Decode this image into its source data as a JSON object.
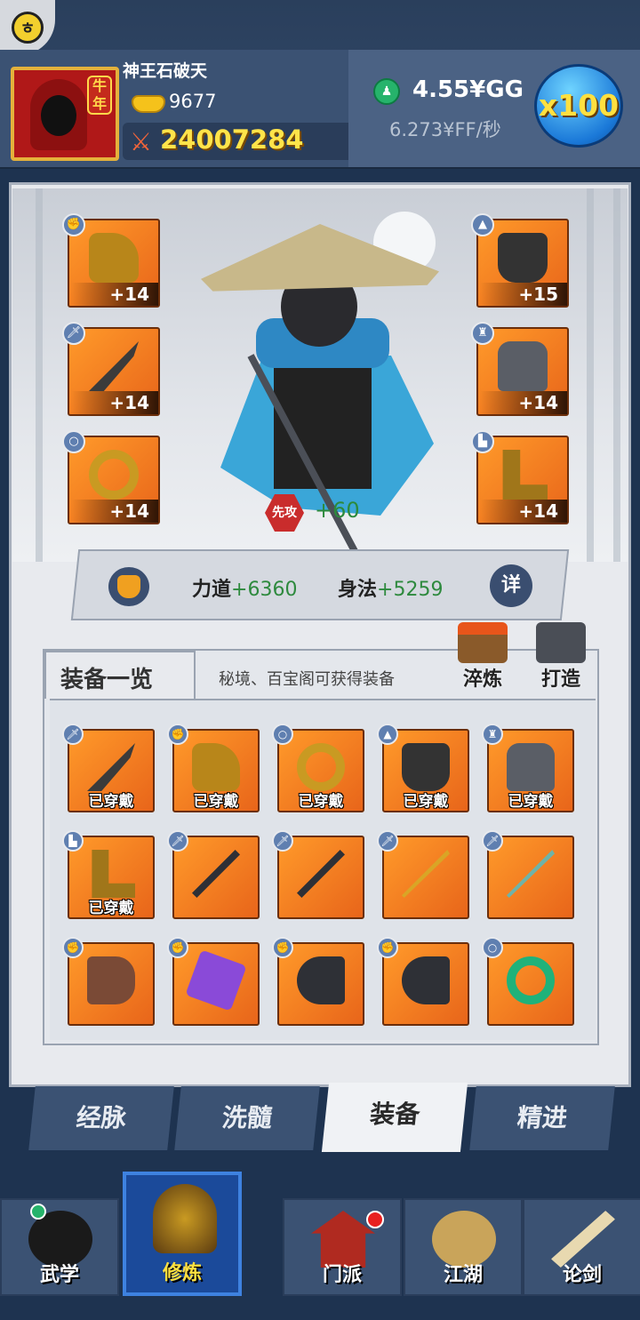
{
  "header": {
    "player_name": "神王石破天",
    "avatar_badge": "牛年",
    "gold": "9677",
    "power": "24007284",
    "gg_amount": "4.55¥GG",
    "ff_rate": "6.273¥FF/秒",
    "multiplier": "x100"
  },
  "character": {
    "initiative_label": "先攻",
    "initiative_value": "+60",
    "slots": [
      {
        "name": "helmet",
        "level": "+14",
        "type_icon": "gauntlet"
      },
      {
        "name": "weapon",
        "level": "+14",
        "type_icon": "sword"
      },
      {
        "name": "ring",
        "level": "+14",
        "type_icon": "ring"
      },
      {
        "name": "hat",
        "level": "+15",
        "type_icon": "hat"
      },
      {
        "name": "armor",
        "level": "+14",
        "type_icon": "armor"
      },
      {
        "name": "boots",
        "level": "+14",
        "type_icon": "boot"
      }
    ]
  },
  "stats": {
    "strength_label": "力道",
    "strength_value": "+6360",
    "agility_label": "身法",
    "agility_value": "+5259",
    "detail_label": "详"
  },
  "equipment_list": {
    "title": "装备一览",
    "hint": "秘境、百宝阁可获得装备",
    "temper_label": "淬炼",
    "forge_label": "打造",
    "worn_label": "已穿戴",
    "items": [
      {
        "name": "dragon-blade",
        "worn": true
      },
      {
        "name": "dragon-gauntlet",
        "worn": true
      },
      {
        "name": "gold-ring",
        "worn": true
      },
      {
        "name": "black-hat",
        "worn": true
      },
      {
        "name": "iron-armor",
        "worn": true
      },
      {
        "name": "gold-boots",
        "worn": true
      },
      {
        "name": "black-sword",
        "worn": false
      },
      {
        "name": "black-sword-2",
        "worn": false
      },
      {
        "name": "golden-trident",
        "worn": false
      },
      {
        "name": "jade-sword",
        "worn": false
      },
      {
        "name": "clay-bracer",
        "worn": false
      },
      {
        "name": "purple-bracer",
        "worn": false
      },
      {
        "name": "iron-bracer",
        "worn": false
      },
      {
        "name": "iron-bracer-2",
        "worn": false
      },
      {
        "name": "jade-ring",
        "worn": false
      }
    ]
  },
  "sub_tabs": [
    "经脉",
    "洗髓",
    "装备",
    "精进"
  ],
  "active_sub_tab": "装备",
  "bottom_nav": [
    "武学",
    "修炼",
    "门派",
    "江湖",
    "论剑"
  ],
  "active_nav": "修炼",
  "colors": {
    "slot_orange": "#ff9a2a",
    "stat_green": "#2e8a3e",
    "power_yellow": "#ffe44a",
    "nav_active": "#1b4a9a"
  }
}
